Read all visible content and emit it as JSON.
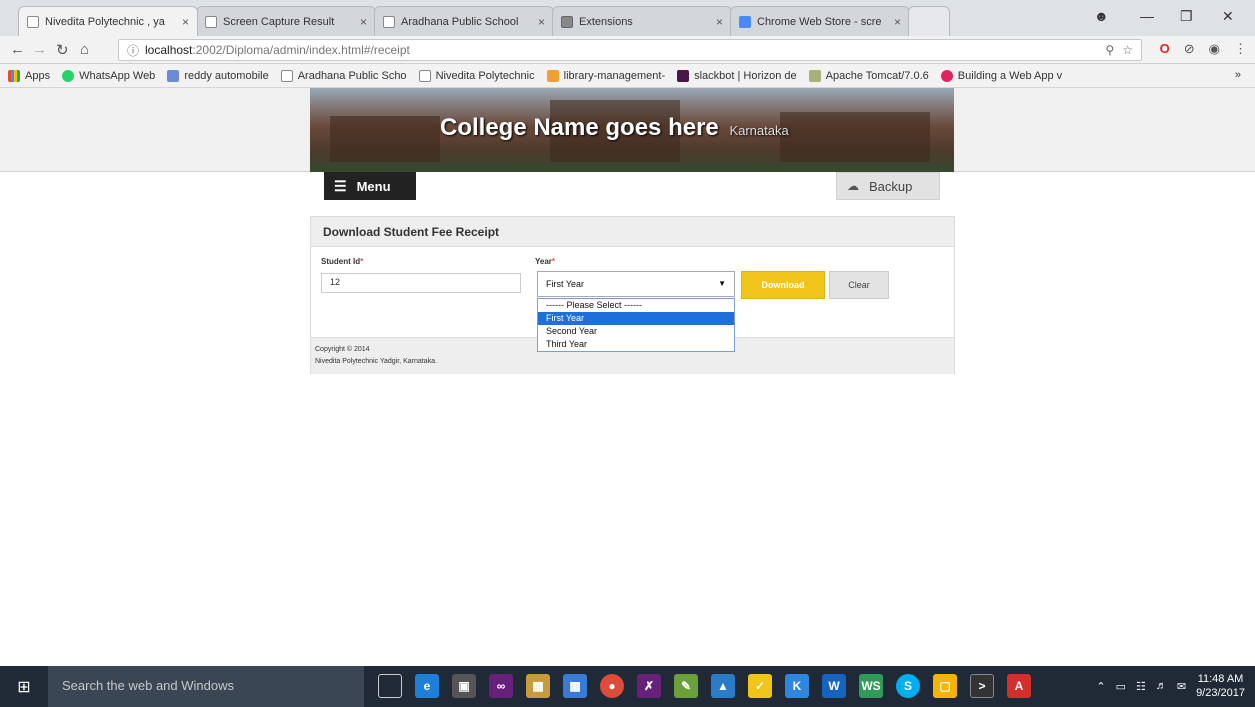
{
  "browser": {
    "tabs": [
      {
        "title": "Nivedita Polytechnic , ya",
        "active": true
      },
      {
        "title": "Screen Capture Result"
      },
      {
        "title": "Aradhana Public School"
      },
      {
        "title": "Extensions"
      },
      {
        "title": "Chrome Web Store - scre"
      }
    ],
    "tab_close": "×",
    "url_host": "localhost",
    "url_path": ":2002/Diploma/admin/index.html#/receipt",
    "bookmarks": [
      {
        "label": "Apps",
        "color": "#e44d26"
      },
      {
        "label": "WhatsApp Web",
        "color": "#25d366"
      },
      {
        "label": "reddy automobile",
        "color": "#6b8bd6"
      },
      {
        "label": "Aradhana Public Scho",
        "color": "#ffffff"
      },
      {
        "label": "Nivedita Polytechnic",
        "color": "#ffffff"
      },
      {
        "label": "library-management-",
        "color": "#f0a030"
      },
      {
        "label": "slackbot | Horizon de",
        "color": "#4a154b"
      },
      {
        "label": "Apache Tomcat/7.0.6",
        "color": "#a5b07a"
      },
      {
        "label": "Building a Web App v",
        "color": "#e0245e"
      }
    ],
    "more_bookmarks": "»"
  },
  "site": {
    "college_name": "College Name goes here",
    "region": "Karnataka",
    "menu_label": "Menu",
    "backup_label": "Backup"
  },
  "form": {
    "title": "Download Student Fee Receipt",
    "student_id_label": "Student Id",
    "student_id_value": "12",
    "year_label": "Year",
    "year_selected": "First Year",
    "required_mark": "*",
    "download_label": "Download",
    "clear_label": "Clear",
    "year_options": [
      "------ Please Select ------",
      "First Year",
      "Second Year",
      "Third Year"
    ]
  },
  "footer": {
    "line1": "Copyright © 2014",
    "line2": "Nivedita Polytechnic Yadgir, Karnataka."
  },
  "taskbar": {
    "search_placeholder": "Search the web and Windows",
    "time": "11:48 AM",
    "date": "9/23/2017"
  },
  "colors": {
    "accent_download": "#f0c419",
    "selected_option": "#1e6fd9",
    "menu_bg": "#222222"
  }
}
